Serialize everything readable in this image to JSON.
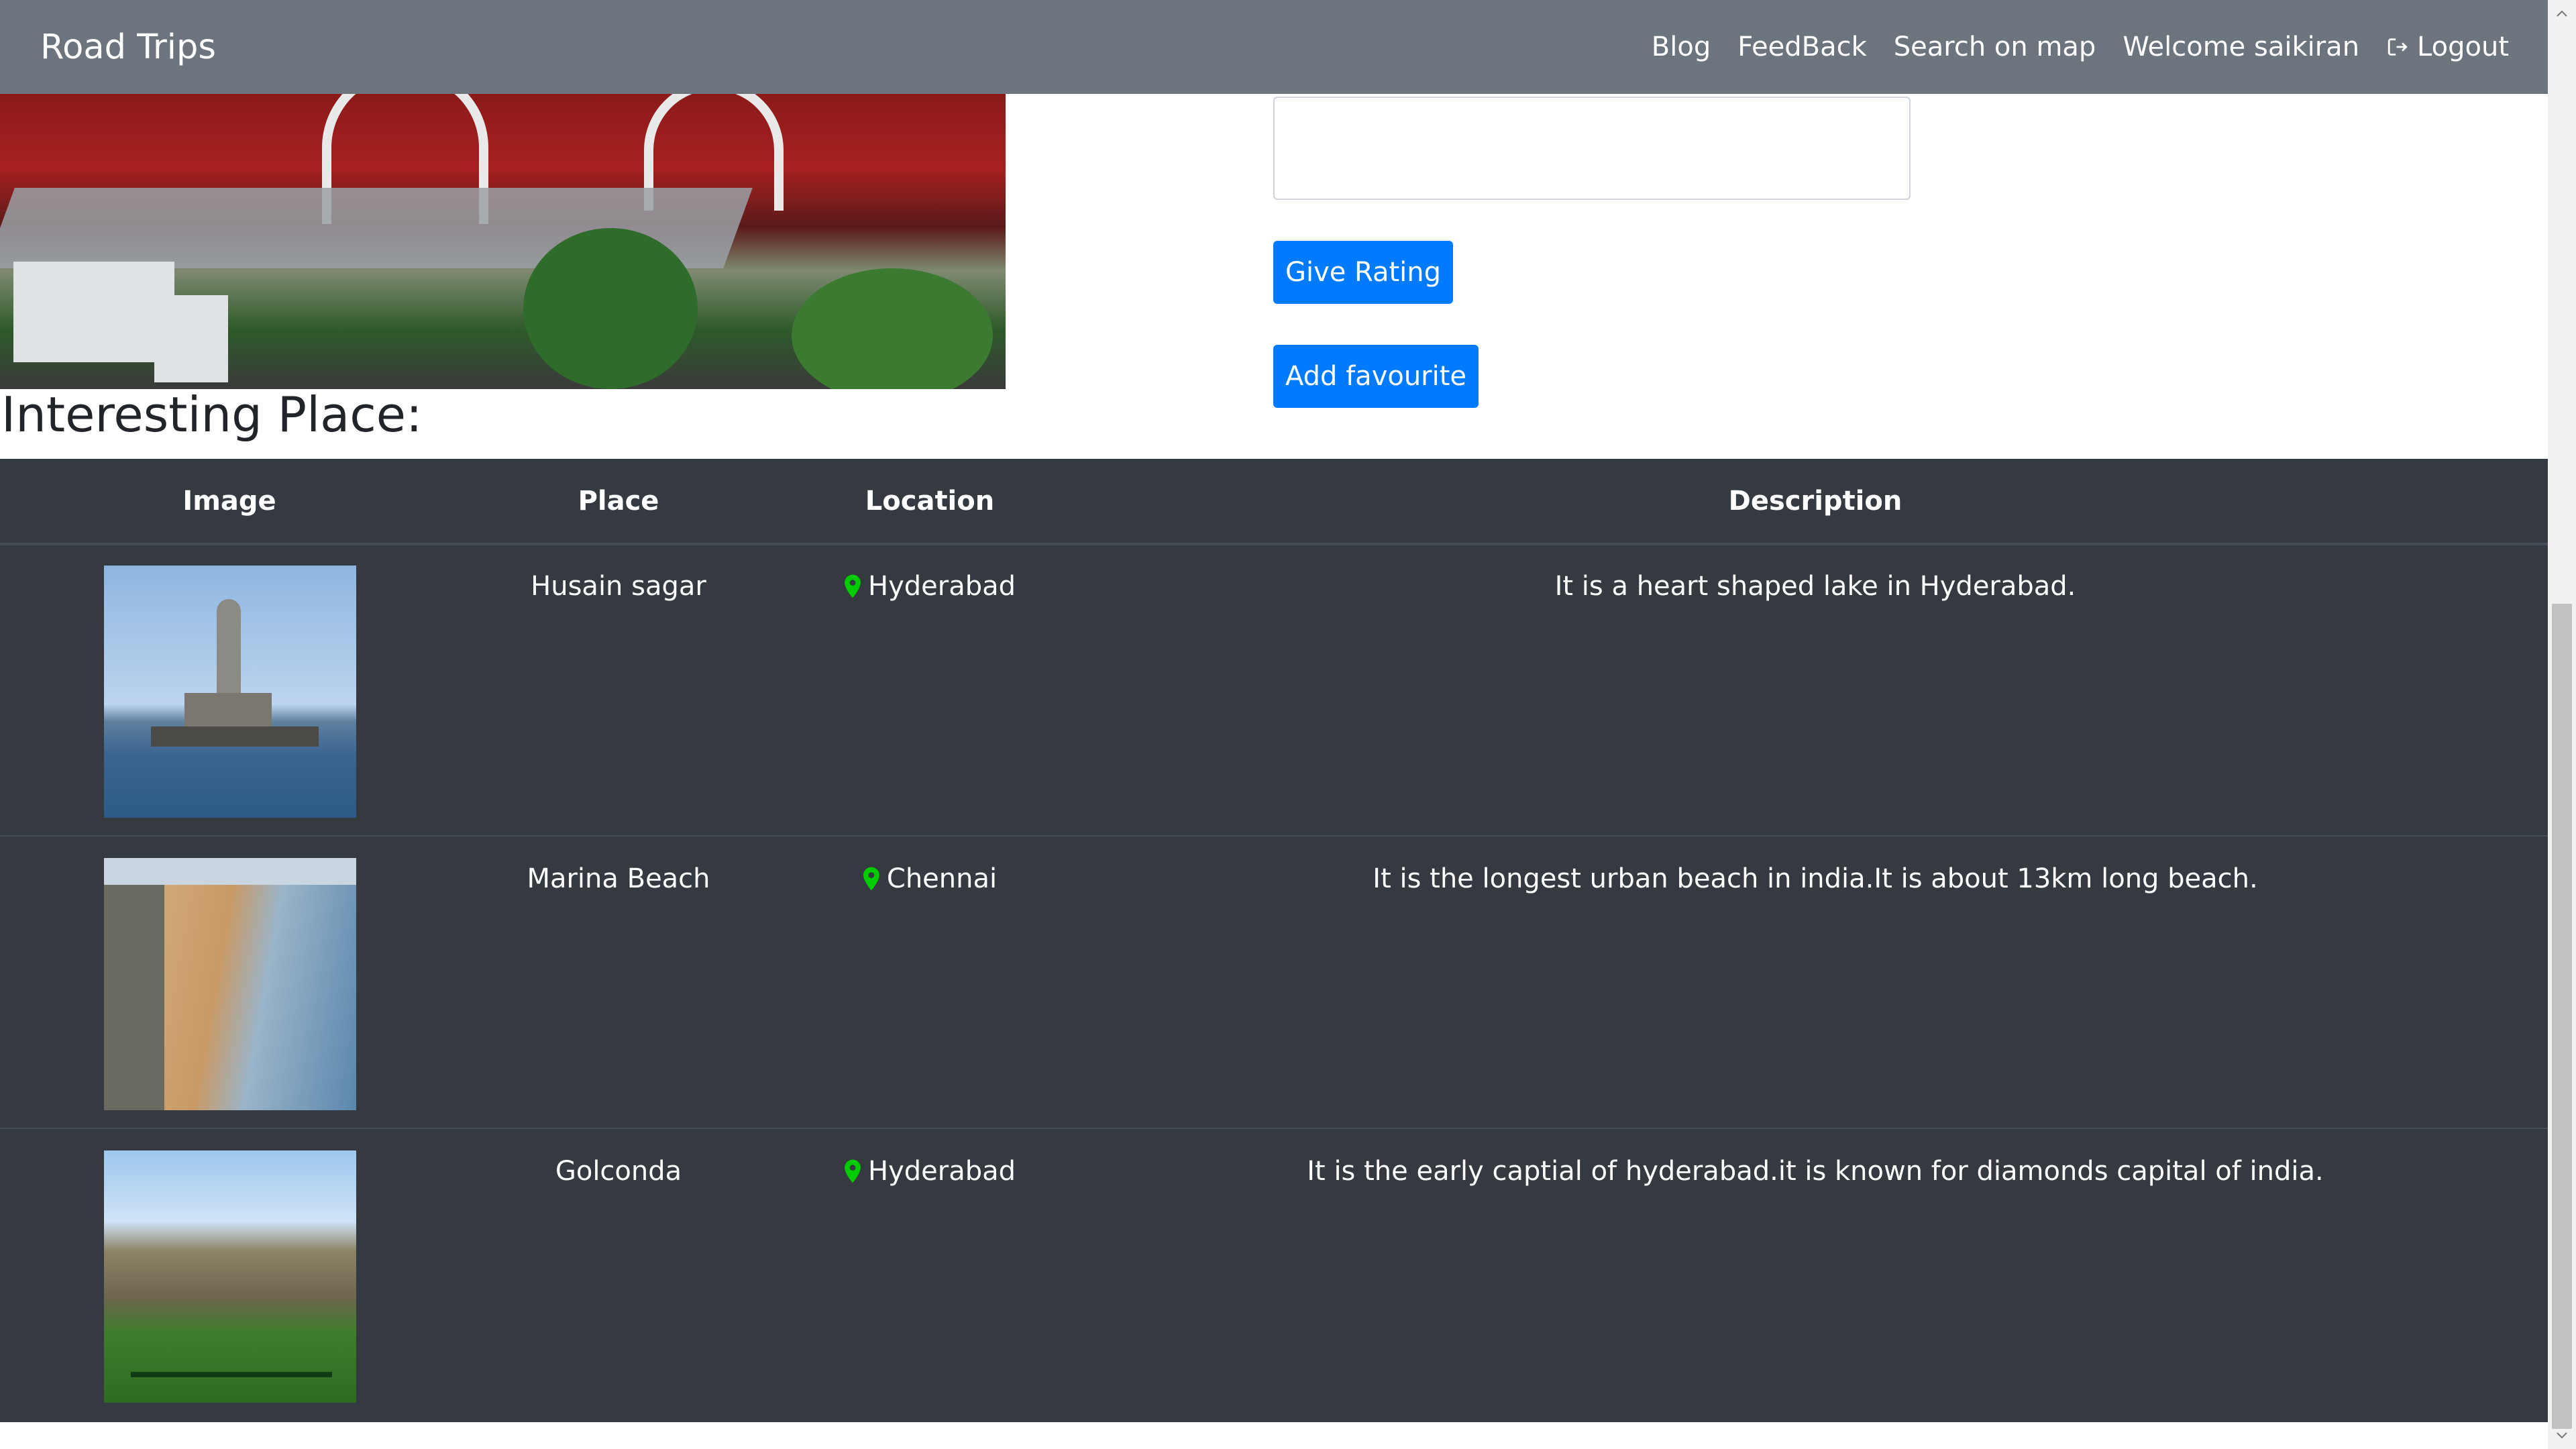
{
  "navbar": {
    "brand": "Road Trips",
    "links": {
      "blog": "Blog",
      "feedback": "FeedBack",
      "search_map": "Search on map",
      "welcome": "Welcome saikiran",
      "logout": "Logout"
    },
    "background": "#6c757d"
  },
  "form": {
    "give_rating": "Give Rating",
    "add_favourite": "Add favourite",
    "button_color": "#007bff"
  },
  "section": {
    "title": "Interesting Place:"
  },
  "table": {
    "headers": {
      "image": "Image",
      "place": "Place",
      "location": "Location",
      "description": "Description"
    },
    "rows": [
      {
        "place": "Husain sagar",
        "location": "Hyderabad",
        "description": "It is a heart shaped lake in Hyderabad.",
        "image_icon": "lake-statue-photo"
      },
      {
        "place": "Marina Beach",
        "location": "Chennai",
        "description": "It is the longest urban beach in india.It is about 13km long beach.",
        "image_icon": "beach-photo"
      },
      {
        "place": "Golconda",
        "location": "Hyderabad",
        "description": "It is the early captial of hyderabad.it is known for diamonds capital of india.",
        "image_icon": "fort-photo"
      }
    ],
    "background": "#343a40",
    "pin_color": "#00cc00"
  }
}
